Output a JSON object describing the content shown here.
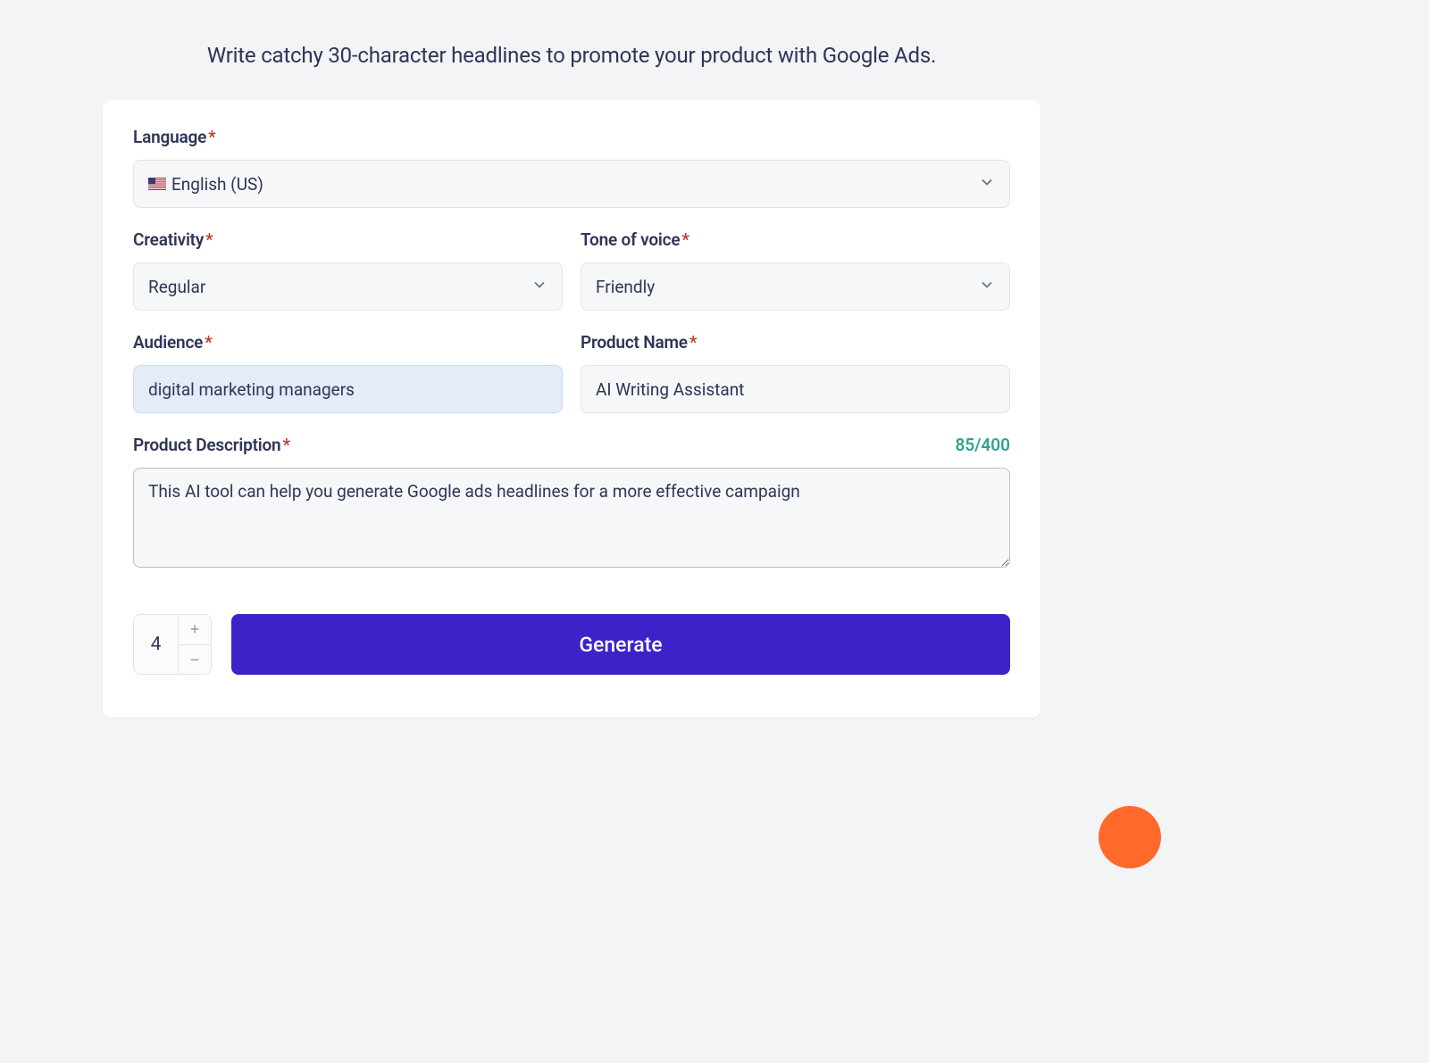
{
  "description": "Write catchy 30-character headlines to promote your product with Google Ads.",
  "labels": {
    "language": "Language",
    "creativity": "Creativity",
    "tone": "Tone of voice",
    "audience": "Audience",
    "productName": "Product Name",
    "productDescription": "Product Description"
  },
  "values": {
    "language": "English (US)",
    "creativity": "Regular",
    "tone": "Friendly",
    "audience": "digital marketing managers",
    "productName": "AI Writing Assistant",
    "productDescription": "This AI tool can help you generate Google ads headlines for a more effective campaign",
    "quantity": "4"
  },
  "charCount": "85/400",
  "generateLabel": "Generate"
}
